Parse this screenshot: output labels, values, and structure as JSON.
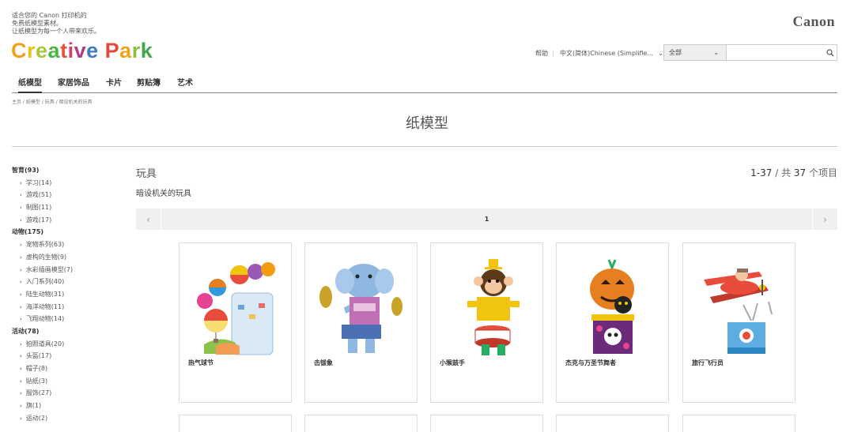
{
  "header": {
    "tagline": [
      "适合您的 Canon 打印机的",
      "免费纸模型素材。",
      "让纸模型为每一个人带来欢乐。"
    ],
    "logo_letters": [
      {
        "ch": "C",
        "color": "#f0a21c"
      },
      {
        "ch": "r",
        "color": "#e8c313"
      },
      {
        "ch": "e",
        "color": "#a7c73c"
      },
      {
        "ch": "a",
        "color": "#4db44a"
      },
      {
        "ch": "t",
        "color": "#e6553b"
      },
      {
        "ch": "i",
        "color": "#d43a6c"
      },
      {
        "ch": "v",
        "color": "#b03c8b"
      },
      {
        "ch": "e",
        "color": "#3f7cc2"
      },
      {
        "ch": " ",
        "color": "#fff"
      },
      {
        "ch": "P",
        "color": "#e14b3c"
      },
      {
        "ch": "a",
        "color": "#f0a21c"
      },
      {
        "ch": "r",
        "color": "#8cbf3f"
      },
      {
        "ch": "k",
        "color": "#3fa84a"
      }
    ],
    "brand": "Canon",
    "help": "帮助",
    "separator": "|",
    "language": "中文(简体)Chinese (Simplifie...",
    "search_scope": "全部",
    "search_placeholder": ""
  },
  "tabs": [
    "纸模型",
    "家居饰品",
    "卡片",
    "剪贴簿",
    "艺术"
  ],
  "breadcrumb": "主页 / 纸模型 / 玩具 / 暗设机关的玩具",
  "page_title": "纸模型",
  "sidebar": [
    {
      "label": "智育(93)",
      "items": [
        "学习(14)",
        "游戏(51)",
        "制图(11)",
        "游戏(17)"
      ]
    },
    {
      "label": "动物(175)",
      "items": [
        "宠物系列(63)",
        "虚构的生物(9)",
        "水彩插画模型(7)",
        "入门系列(40)",
        "陆生动物(31)",
        "海洋动物(11)",
        "飞翔动物(14)"
      ]
    },
    {
      "label": "活动(78)",
      "items": [
        "拍照道具(20)",
        "头盔(17)",
        "帽子(8)",
        "贴纸(3)",
        "服饰(27)",
        "旗(1)",
        "运动(2)"
      ]
    }
  ],
  "main": {
    "section_title": "玩具",
    "count_range": "1-37",
    "count_sep": " / 共 ",
    "count_total": "37",
    "count_suffix": " 个项目",
    "subtitle": "暗设机关的玩具",
    "page_number": "1",
    "prev": "‹",
    "next": "›",
    "cards": [
      {
        "label": "热气球节",
        "art": "balloons"
      },
      {
        "label": "击钹象",
        "art": "elephant"
      },
      {
        "label": "小猴鼓手",
        "art": "monkey"
      },
      {
        "label": "杰克与万圣节舞者",
        "art": "halloween"
      },
      {
        "label": "旅行飞行员",
        "art": "plane"
      }
    ]
  },
  "colors": {
    "accent": "#333333",
    "pager_bg": "#f0f0f0"
  }
}
